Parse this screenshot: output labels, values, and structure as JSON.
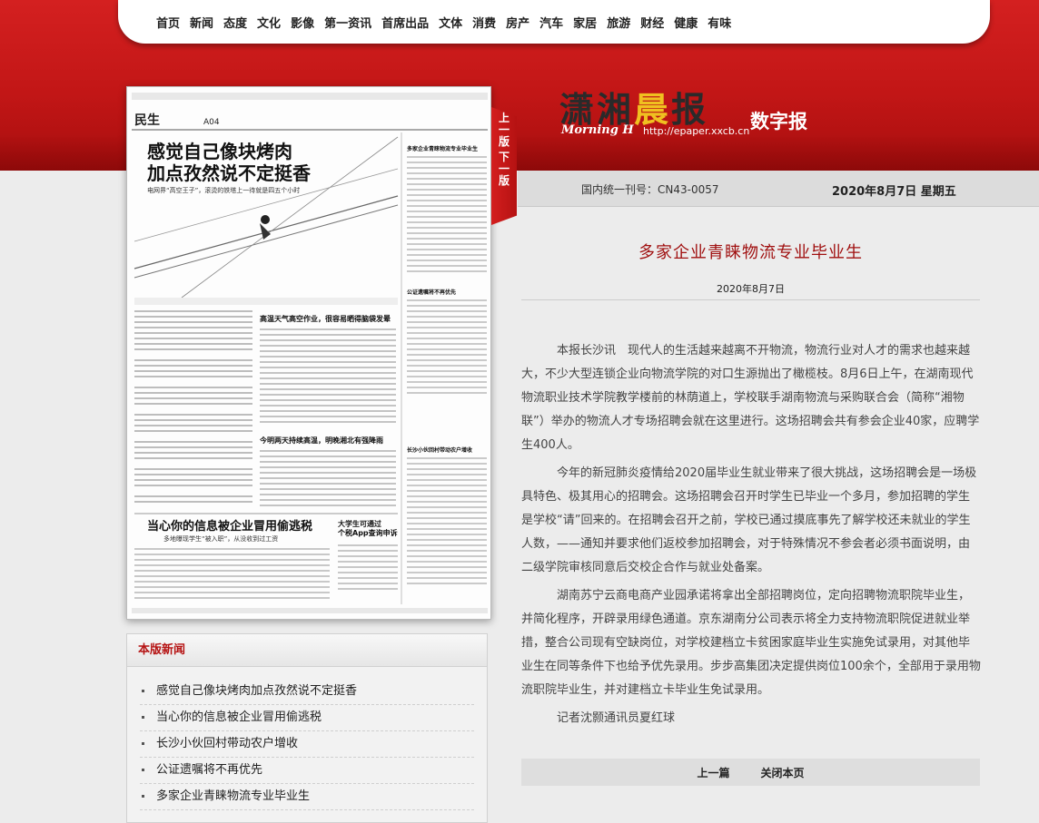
{
  "nav": [
    "首页",
    "新闻",
    "态度",
    "文化",
    "影像",
    "第一资讯",
    "首席出品",
    "文体",
    "消费",
    "房产",
    "汽车",
    "家居",
    "旅游",
    "财经",
    "健康",
    "有味"
  ],
  "logo": {
    "name_a": "潇湘",
    "name_b": "晨",
    "name_c": "报",
    "english": "Morning H",
    "url": "http://epaper.xxcb.cn",
    "digital": "数字报"
  },
  "pager": {
    "prev": "上一版",
    "next": "下一版"
  },
  "meta": {
    "issn": "国内统一刊号：CN43-0057",
    "date": "2020年8月7日 星期五"
  },
  "scan": {
    "section": "民生",
    "page": "A04",
    "headline1": "感觉自己像块烤肉",
    "headline2": "加点孜然说不定挺香",
    "subhead": "电网界“高空王子”，滚烫的铁塔上一待就是四五个小时",
    "mid1": "高温天气高空作业，很容易晒得脑袋发晕",
    "mid2": "今明两天持续高温，明晚湘北有强降雨",
    "bottom": "当心你的信息被企业冒用偷逃税",
    "bottom_sub": "多地曝现学生“被入职”，从没收到过工资",
    "side1": "大学生可通过",
    "side2": "个税App查询申诉",
    "right1": "多家企业青睐物流专业毕业生",
    "right2": "公证遗嘱将不再优先",
    "right3": "长沙小伙回村带动农户增收"
  },
  "article": {
    "title": "多家企业青睐物流专业毕业生",
    "date": "2020年8月7日",
    "paragraphs": [
      "本报长沙讯　现代人的生活越来越离不开物流，物流行业对人才的需求也越来越大，不少大型连锁企业向物流学院的对口生源抛出了橄榄枝。8月6日上午，在湖南现代物流职业技术学院教学楼前的林荫道上，学校联手湖南物流与采购联合会（简称“湘物联”）举办的物流人才专场招聘会就在这里进行。这场招聘会共有参会企业40家，应聘学生400人。",
      "今年的新冠肺炎疫情给2020届毕业生就业带来了很大挑战，这场招聘会是一场极具特色、极其用心的招聘会。这场招聘会召开时学生已毕业一个多月，参加招聘的学生是学校“请”回来的。在招聘会召开之前，学校已通过摸底事先了解学校还未就业的学生人数，——通知并要求他们返校参加招聘会，对于特殊情况不参会者必须书面说明，由二级学院审核同意后交校企合作与就业处备案。",
      "湖南苏宁云商电商产业园承诺将拿出全部招聘岗位，定向招聘物流职院毕业生，并简化程序，开辟录用绿色通道。京东湖南分公司表示将全力支持物流职院促进就业举措，整合公司现有空缺岗位，对学校建档立卡贫困家庭毕业生实施免试录用，对其他毕业生在同等条件下也给予优先录用。步步高集团决定提供岗位100余个，全部用于录用物流职院毕业生，并对建档立卡毕业生免试录用。"
    ],
    "author": "记者沈颢通讯员夏红球",
    "prev": "上一篇",
    "close": "关闭本页"
  },
  "news": {
    "heading": "本版新闻",
    "items": [
      "感觉自己像块烤肉加点孜然说不定挺香",
      "当心你的信息被企业冒用偷逃税",
      "长沙小伙回村带动农户增收",
      "公证遗嘱将不再优先",
      "多家企业青睐物流专业毕业生"
    ]
  }
}
